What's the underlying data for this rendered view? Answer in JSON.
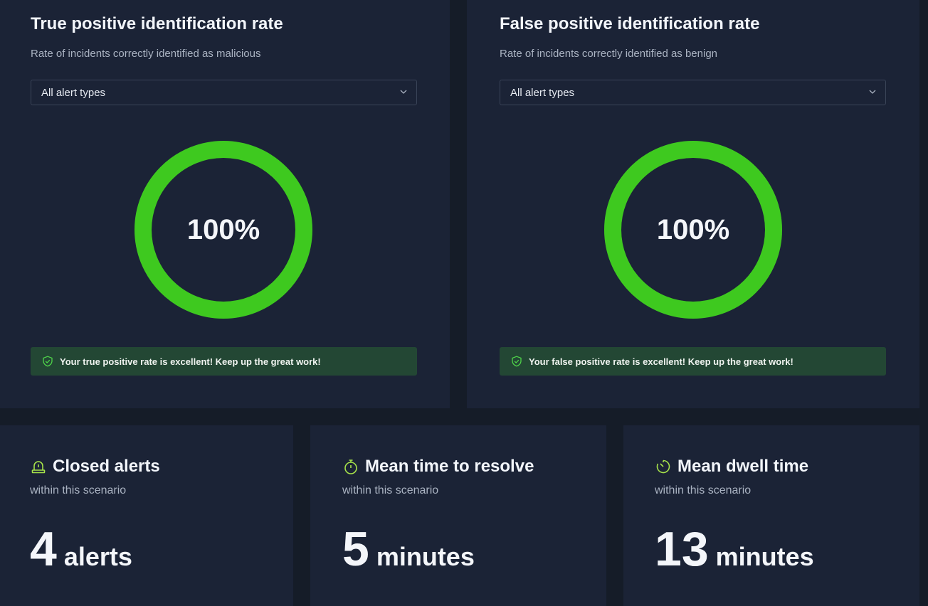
{
  "true_positive": {
    "title": "True positive identification rate",
    "subtitle": "Rate of incidents correctly identified as malicious",
    "dropdown_value": "All alert types",
    "rate_label": "100%",
    "rate_fraction": 1.0,
    "banner": "Your true positive rate is excellent! Keep up the great work!"
  },
  "false_positive": {
    "title": "False positive identification rate",
    "subtitle": "Rate of incidents correctly identified as benign",
    "dropdown_value": "All alert types",
    "rate_label": "100%",
    "rate_fraction": 1.0,
    "banner": "Your false positive rate is excellent! Keep up the great work!"
  },
  "metrics": {
    "closed_alerts": {
      "title": "Closed alerts",
      "subtitle": "within this scenario",
      "value": "4",
      "unit": "alerts",
      "icon": "siren-icon"
    },
    "mean_time_to_resolve": {
      "title": "Mean time to resolve",
      "subtitle": "within this scenario",
      "value": "5",
      "unit": "minutes",
      "icon": "stopwatch-icon"
    },
    "mean_dwell_time": {
      "title": "Mean dwell time",
      "subtitle": "within this scenario",
      "value": "13",
      "unit": "minutes",
      "icon": "timer-icon"
    }
  },
  "colors": {
    "background": "#151c28",
    "card": "#1b2336",
    "gauge_green": "#3ec91f",
    "accent_icon": "#a7e34a",
    "banner_bg": "#234734"
  }
}
